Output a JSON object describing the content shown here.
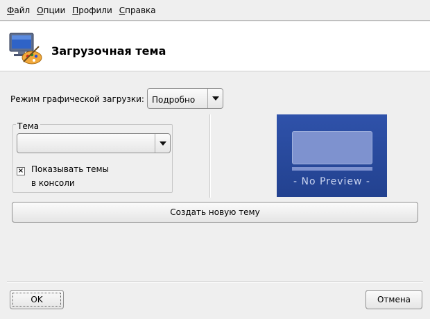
{
  "menubar": {
    "items": [
      {
        "accel": "Ф",
        "rest": "айл"
      },
      {
        "accel": "О",
        "rest": "пции"
      },
      {
        "accel": "П",
        "rest": "рофили"
      },
      {
        "accel": "С",
        "rest": "правка"
      }
    ]
  },
  "header": {
    "title": "Загрузочная тема",
    "icon": "monitor-palette-icon"
  },
  "mode": {
    "label": "Режим графической загрузки:",
    "selected": "Подробно"
  },
  "theme_group": {
    "title": "Тема",
    "selected": "",
    "checkbox": {
      "checked": true,
      "mark": "×",
      "label_line1": "Показывать темы",
      "label_line2": "в консоли"
    }
  },
  "preview": {
    "text": "- No Preview -"
  },
  "buttons": {
    "create": "Создать новую тему",
    "ok": "OK",
    "cancel": "Отмена"
  }
}
